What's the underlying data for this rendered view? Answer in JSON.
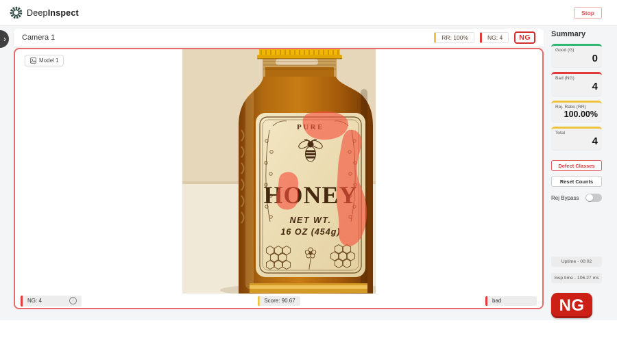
{
  "app": {
    "title_regular": "Deep",
    "title_bold": "Inspect",
    "stop_label": "Stop"
  },
  "camera": {
    "title": "Camera 1",
    "rr_chip": "RR: 100%",
    "ng_chip": "NG: 4",
    "status_badge": "NG",
    "model_chip": "Model 1",
    "footer": {
      "ng_count": "NG: 4",
      "score": "Score: 90.67",
      "class_label": "bad"
    }
  },
  "bottle_label": {
    "pure": "PURE",
    "honey": "HONEY",
    "net_wt": "NET WT.",
    "size": "16 OZ (454g)"
  },
  "summary": {
    "heading": "Summary",
    "cards": [
      {
        "label": "Good (G)",
        "value": "0",
        "accent": "#2eb872"
      },
      {
        "label": "Bad (NG)",
        "value": "4",
        "accent": "#e23b3b"
      },
      {
        "label": "Rej. Ratio (RR)",
        "value": "100.00%",
        "accent": "#f0c33c"
      },
      {
        "label": "Total",
        "value": "4",
        "accent": "#f0c33c"
      }
    ],
    "defect_classes_label": "Defect Classes",
    "reset_counts_label": "Reset Counts",
    "rej_bypass_label": "Rej Bypass",
    "rej_bypass_state": "off",
    "uptime": "Uptime - 00:02",
    "insp_time": "Insp time - 106.27 ms",
    "result_badge": "NG"
  },
  "colors": {
    "good_accent": "#2eb872",
    "bad_accent": "#e23b3b",
    "warn_accent": "#f0c33c",
    "panel_border": "#e66a6a",
    "ng_badge": "#d32f2f",
    "result_badge_bg": "#cc1f16",
    "defect_overlay": "#f4503c"
  }
}
